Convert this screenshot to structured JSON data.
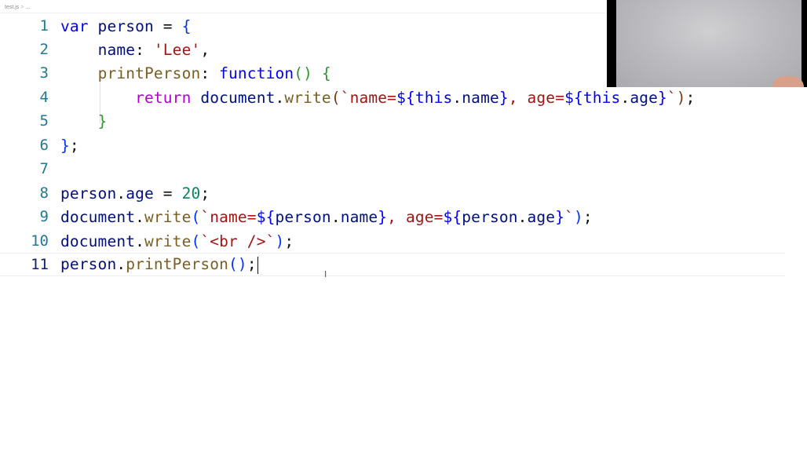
{
  "breadcrumb": {
    "file": "test.js",
    "separator": ">",
    "ellipsis": "..."
  },
  "editor": {
    "current_line": 11,
    "lines": [
      {
        "num": "1"
      },
      {
        "num": "2"
      },
      {
        "num": "3"
      },
      {
        "num": "4"
      },
      {
        "num": "5"
      },
      {
        "num": "6"
      },
      {
        "num": "7"
      },
      {
        "num": "8"
      },
      {
        "num": "9"
      },
      {
        "num": "10"
      },
      {
        "num": "11"
      }
    ],
    "tokens": {
      "l1": [
        "var",
        " person ",
        "=",
        " ",
        "{"
      ],
      "l2": [
        "    ",
        "name",
        ": ",
        "'Lee'",
        ","
      ],
      "l3": [
        "    ",
        "printPerson",
        ": ",
        "function",
        "()",
        " ",
        "{"
      ],
      "l4": [
        "        ",
        "return",
        " ",
        "document",
        ".",
        "write",
        "(",
        "`name=",
        "${",
        "this",
        ".",
        "name",
        "}",
        ", age=",
        "${",
        "this",
        ".",
        "age",
        "}",
        "`",
        ")",
        ";"
      ],
      "l5": [
        "    ",
        "}"
      ],
      "l6": [
        "}",
        ";"
      ],
      "l7": [
        ""
      ],
      "l8": [
        "person",
        ".",
        "age",
        " = ",
        "20",
        ";"
      ],
      "l9": [
        "document",
        ".",
        "write",
        "(",
        "`name=",
        "${",
        "person",
        ".",
        "name",
        "}",
        ", age=",
        "${",
        "person",
        ".",
        "age",
        "}",
        "`",
        ")",
        ";"
      ],
      "l10": [
        "document",
        ".",
        "write",
        "(",
        "`<br />`",
        ")",
        ";"
      ],
      "l11": [
        "person",
        ".",
        "printPerson",
        "()",
        ";"
      ]
    }
  },
  "cursor": {
    "glyph": "I"
  },
  "colors": {
    "keyword": "#0000ff",
    "string": "#a31515",
    "number": "#098658",
    "function": "#795e26",
    "variable": "#001080",
    "line_number": "#237893"
  }
}
